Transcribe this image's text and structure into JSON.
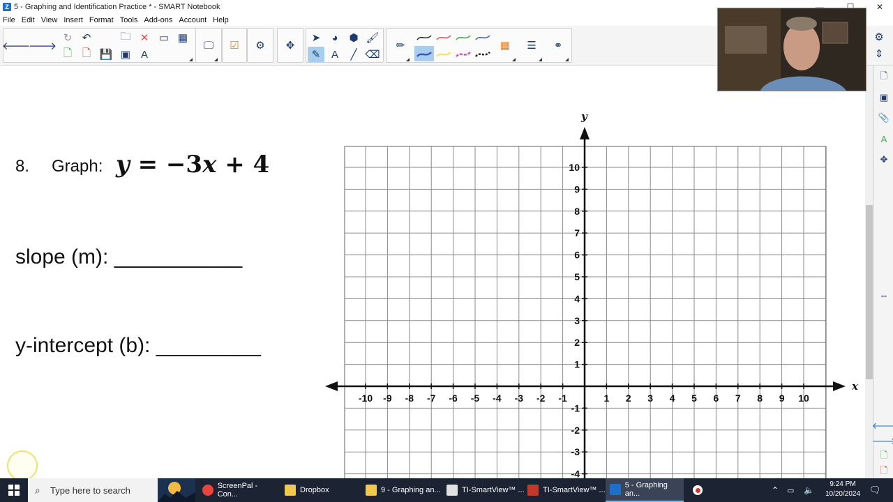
{
  "window": {
    "title": "5 - Graphing and Identification Practice * - SMART Notebook",
    "minimize": "—",
    "maximize": "☐",
    "close": "✕"
  },
  "menu": [
    "File",
    "Edit",
    "View",
    "Insert",
    "Format",
    "Tools",
    "Add-ons",
    "Account",
    "Help"
  ],
  "question": {
    "number": "8.",
    "graph_label": "Graph:",
    "equation": {
      "y": "y",
      "eq": " = −3",
      "x": "x",
      "rest": " + 4"
    },
    "slope_label": "slope (m): ___________",
    "intercept_label": "y-intercept (b): _________"
  },
  "graph": {
    "x_axis_label": "x",
    "y_axis_label": "y",
    "x_ticks": [
      -10,
      -9,
      -8,
      -7,
      -6,
      -5,
      -4,
      -3,
      -2,
      -1,
      1,
      2,
      3,
      4,
      5,
      6,
      7,
      8,
      9,
      10
    ],
    "y_ticks": [
      10,
      9,
      8,
      7,
      6,
      5,
      4,
      3,
      2,
      1,
      -1,
      -2,
      -3,
      -4
    ],
    "xlim": [
      -11,
      11
    ],
    "ylim": [
      -4,
      11
    ]
  },
  "taskbar": {
    "search_placeholder": "Type here to search",
    "apps": [
      {
        "label": "ScreenPal - Con...",
        "color": "#e8453c"
      },
      {
        "label": "Dropbox",
        "color": "#f2c94c"
      },
      {
        "label": "9 - Graphing an...",
        "color": "#f2c94c"
      },
      {
        "label": "TI-SmartView™ ...",
        "color": "#e0e0e0"
      },
      {
        "label": "TI-SmartView™ ...",
        "color": "#c0392b"
      },
      {
        "label": "5 - Graphing an...",
        "color": "#1d6fc9"
      }
    ],
    "time": "9:24 PM",
    "date": "10/20/2024"
  },
  "colors": {
    "toolbar_bg": "#f4f4f4",
    "taskbar_bg": "#1c2433",
    "grid_line": "#8a8a8a",
    "axis": "#111111"
  }
}
